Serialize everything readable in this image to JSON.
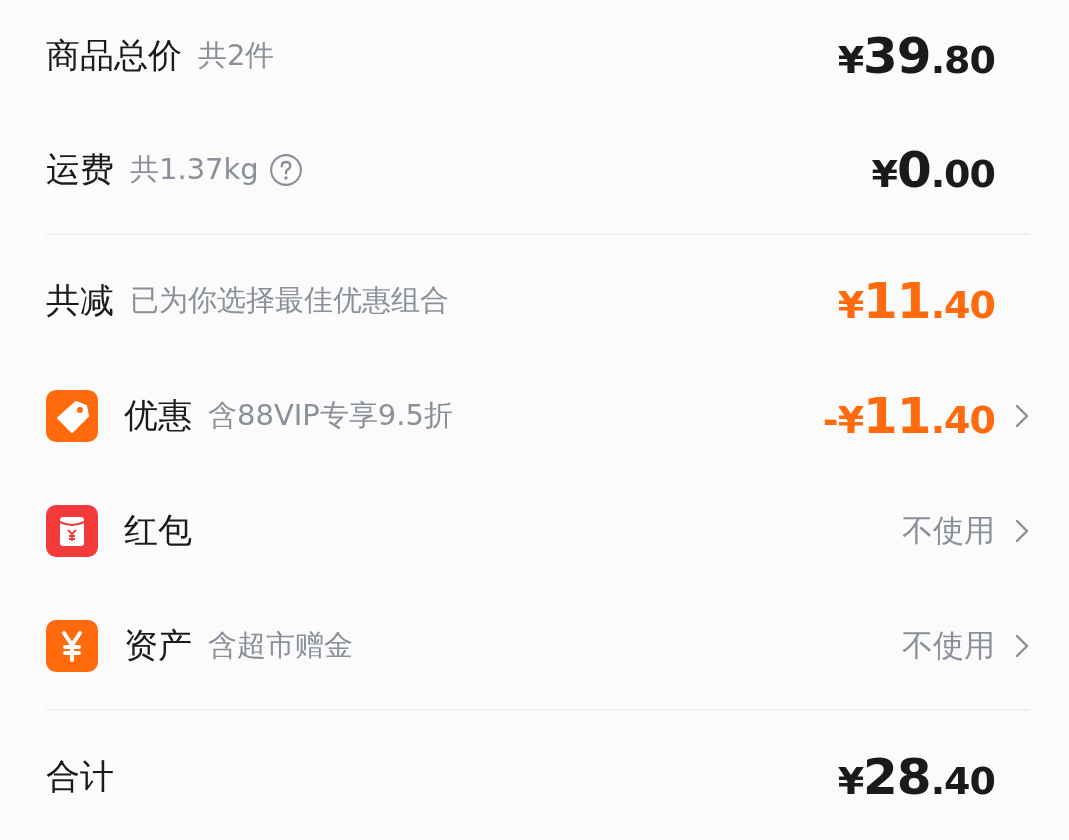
{
  "sections": [
    {
      "rows": [
        {
          "kind": "goods",
          "label": "商品总价",
          "note": "共2件",
          "value": "¥39.80",
          "emphasis": false
        },
        {
          "kind": "shipping",
          "label": "运费",
          "note": "共1.37kg",
          "value": "¥0.00",
          "emphasis": false
        }
      ]
    },
    {
      "rows": [
        {
          "kind": "reduction",
          "label": "共减",
          "note": "已为你选择最佳优惠组合",
          "value": "¥11.40",
          "emphasis": true
        },
        {
          "kind": "promo",
          "label": "优惠",
          "note": "含88VIP专享9.5折",
          "value": "-¥11.40",
          "emphasis": true
        },
        {
          "kind": "redpacket",
          "label": "红包",
          "value": "不使用",
          "emphasis": false
        },
        {
          "kind": "assets",
          "label": "资产",
          "note": "含超市赠金",
          "value": "不使用",
          "emphasis": false
        }
      ]
    },
    {
      "rows": [
        {
          "kind": "total",
          "label": "合计",
          "value": "¥28.40",
          "emphasis": false
        }
      ]
    }
  ]
}
